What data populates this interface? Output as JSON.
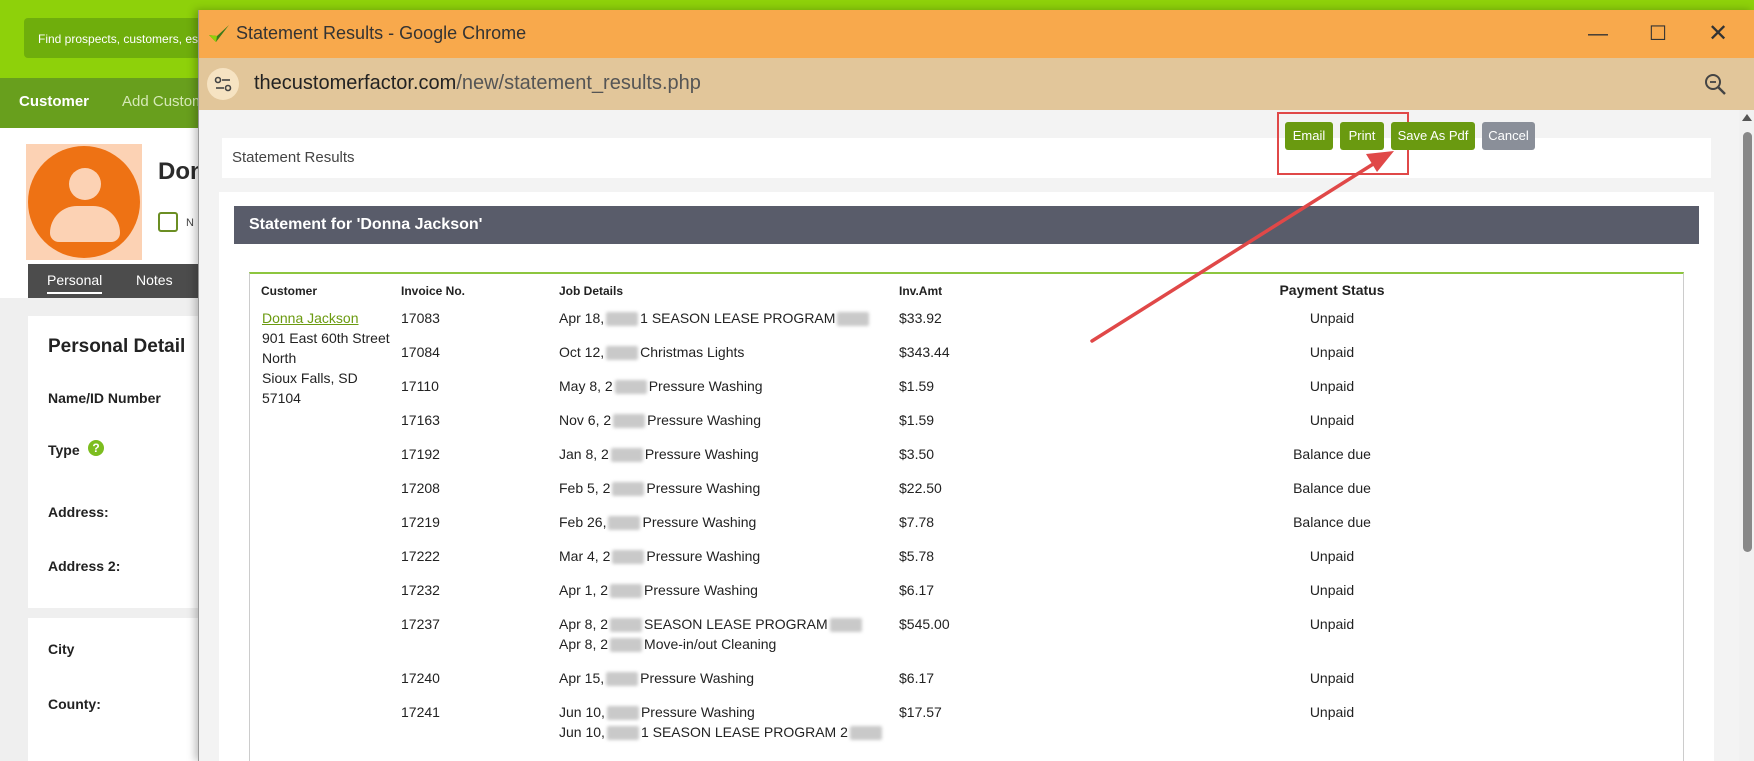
{
  "background_app": {
    "search_text": "Find prospects, customers, estimates",
    "nav": [
      "Customer",
      "Add Custom"
    ],
    "customer_name_partial": "Don",
    "checkbox_label_partial": "N",
    "subtabs": [
      "Personal",
      "Notes"
    ],
    "panel_title": "Personal Detail",
    "labels": [
      "Name/ID Number",
      "Type",
      "Address:",
      "Address 2:"
    ],
    "labels2": [
      "City",
      "County:"
    ]
  },
  "window": {
    "title": "Statement Results - Google Chrome",
    "url_host": "thecustomerfactor.com",
    "url_path": "/new/statement_results.php"
  },
  "results": {
    "title": "Statement Results",
    "buttons": {
      "email": "Email",
      "print": "Print",
      "save_pdf": "Save As Pdf",
      "cancel": "Cancel"
    }
  },
  "statement": {
    "title": "Statement for 'Donna Jackson'",
    "headers": {
      "customer": "Customer",
      "invoice": "Invoice No.",
      "job": "Job Details",
      "amount": "Inv.Amt",
      "status": "Payment Status"
    },
    "customer": {
      "name": "Donna Jackson",
      "address": [
        "901 East 60th Street",
        "North",
        "Sioux Falls, SD",
        "57104"
      ]
    },
    "rows": [
      {
        "invoice": "17083",
        "job_pre": "Apr 18,",
        "job_post": "1 SEASON LEASE PROGRAM",
        "amount": "$33.92",
        "status": "Unpaid"
      },
      {
        "invoice": "17084",
        "job_pre": "Oct 12,",
        "job_post": "Christmas Lights",
        "amount": "$343.44",
        "status": "Unpaid"
      },
      {
        "invoice": "17110",
        "job_pre": "May 8, 2",
        "job_post": "Pressure Washing",
        "amount": "$1.59",
        "status": "Unpaid"
      },
      {
        "invoice": "17163",
        "job_pre": "Nov 6, 2",
        "job_post": "Pressure Washing",
        "amount": "$1.59",
        "status": "Unpaid"
      },
      {
        "invoice": "17192",
        "job_pre": "Jan 8, 2",
        "job_post": "Pressure Washing",
        "amount": "$3.50",
        "status": "Balance due"
      },
      {
        "invoice": "17208",
        "job_pre": "Feb 5, 2",
        "job_post": "Pressure Washing",
        "amount": "$22.50",
        "status": "Balance due"
      },
      {
        "invoice": "17219",
        "job_pre": "Feb 26,",
        "job_post": "Pressure Washing",
        "amount": "$7.78",
        "status": "Balance due"
      },
      {
        "invoice": "17222",
        "job_pre": "Mar 4, 2",
        "job_post": "Pressure Washing",
        "amount": "$5.78",
        "status": "Unpaid"
      },
      {
        "invoice": "17232",
        "job_pre": "Apr 1, 2",
        "job_post": "Pressure Washing",
        "amount": "$6.17",
        "status": "Unpaid"
      },
      {
        "invoice": "17237",
        "job_pre": "Apr 8, 2",
        "job_post": "SEASON LEASE PROGRAM",
        "job2_pre": "Apr 8, 2",
        "job2_post": "Move-in/out Cleaning",
        "amount": "$545.00",
        "status": "Unpaid"
      },
      {
        "invoice": "17240",
        "job_pre": "Apr 15,",
        "job_post": "Pressure Washing",
        "amount": "$6.17",
        "status": "Unpaid"
      },
      {
        "invoice": "17241",
        "job_pre": "Jun 10,",
        "job_post": "Pressure Washing",
        "job2_pre": "Jun 10,",
        "job2_post": "1 SEASON LEASE PROGRAM 2",
        "amount": "$17.57",
        "status": "Unpaid"
      }
    ]
  },
  "colors": {
    "titlebar": "#f8a94c",
    "addressbar": "#e2c69a",
    "button_green": "#6a9a10",
    "button_gray": "#8a8f99",
    "banner": "#595c6a",
    "highlight": "#e04848"
  }
}
